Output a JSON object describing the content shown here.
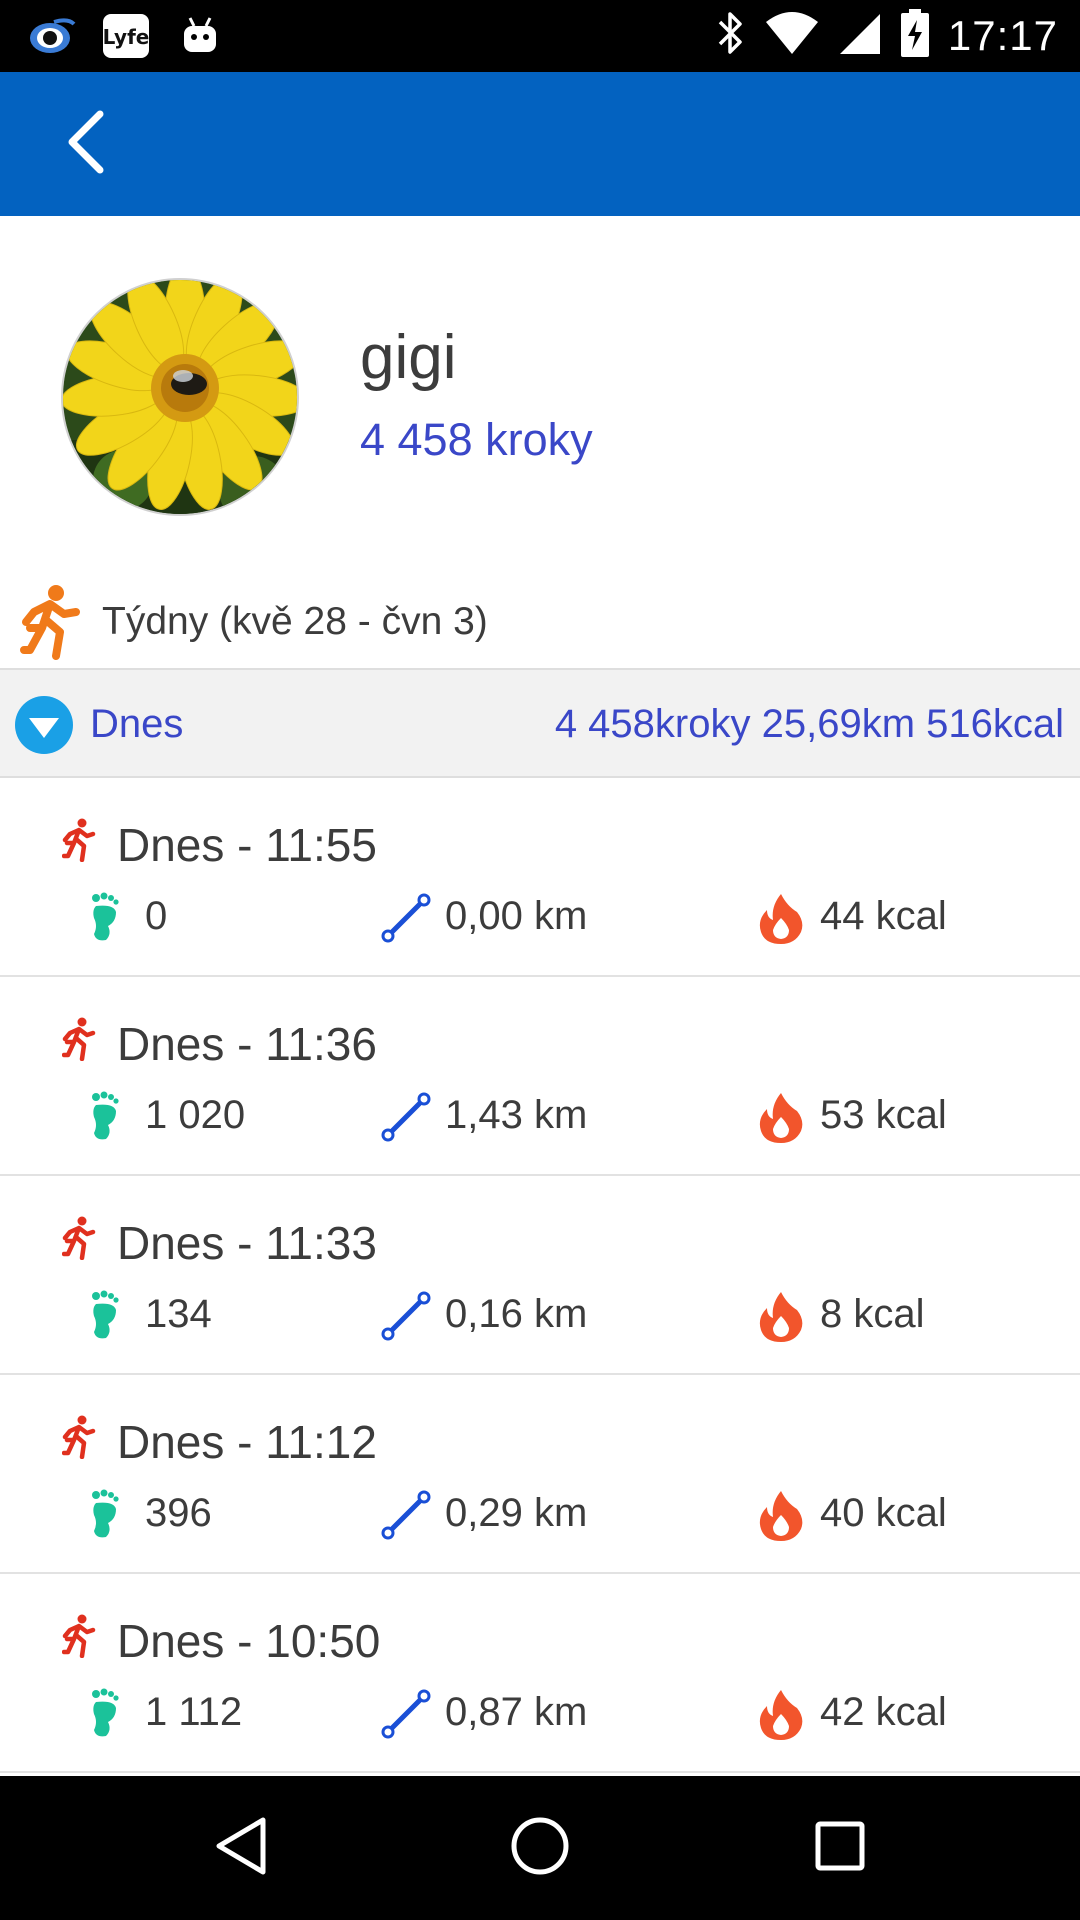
{
  "status_bar": {
    "time": "17:17",
    "left_icons": [
      "eye-app-icon",
      "lyfe-app-icon",
      "android-robot-icon"
    ],
    "right_icons": [
      "bluetooth-icon",
      "wifi-icon",
      "signal-icon",
      "battery-charging-icon"
    ]
  },
  "app_bar": {
    "back_icon": "chevron-left-icon",
    "color": "#0362c0"
  },
  "profile": {
    "name": "gigi",
    "steps": "4 458 kroky",
    "avatar": "yellow-flower-with-bee"
  },
  "week": {
    "label": "Týdny (kvě 28 - čvn 3)",
    "icon": "running-person-icon"
  },
  "day_summary": {
    "label": "Dnes",
    "totals": "4 458kroky 25,69km 516kcal",
    "icon": "expand-down-icon"
  },
  "activities": [
    {
      "title": "Dnes - 11:55",
      "steps": "0",
      "distance": "0,00 km",
      "kcal": "44 kcal"
    },
    {
      "title": "Dnes - 11:36",
      "steps": "1 020",
      "distance": "1,43 km",
      "kcal": "53 kcal"
    },
    {
      "title": "Dnes - 11:33",
      "steps": "134",
      "distance": "0,16 km",
      "kcal": "8 kcal"
    },
    {
      "title": "Dnes - 11:12",
      "steps": "396",
      "distance": "0,29 km",
      "kcal": "40 kcal"
    },
    {
      "title": "Dnes - 10:50",
      "steps": "1 112",
      "distance": "0,87 km",
      "kcal": "42 kcal"
    }
  ],
  "colors": {
    "accent_blue": "#3a47c8",
    "app_bar": "#0362c0",
    "run_icon_red": "#e0301e",
    "steps_green": "#1bc29a",
    "distance_blue": "#1a4fd6",
    "kcal_orange": "#f2552c",
    "week_icon_orange": "#f07a1a",
    "expand_icon_blue": "#1aa0e6"
  },
  "nav_bar": {
    "icons": [
      "nav-back-icon",
      "nav-home-icon",
      "nav-recents-icon"
    ]
  }
}
